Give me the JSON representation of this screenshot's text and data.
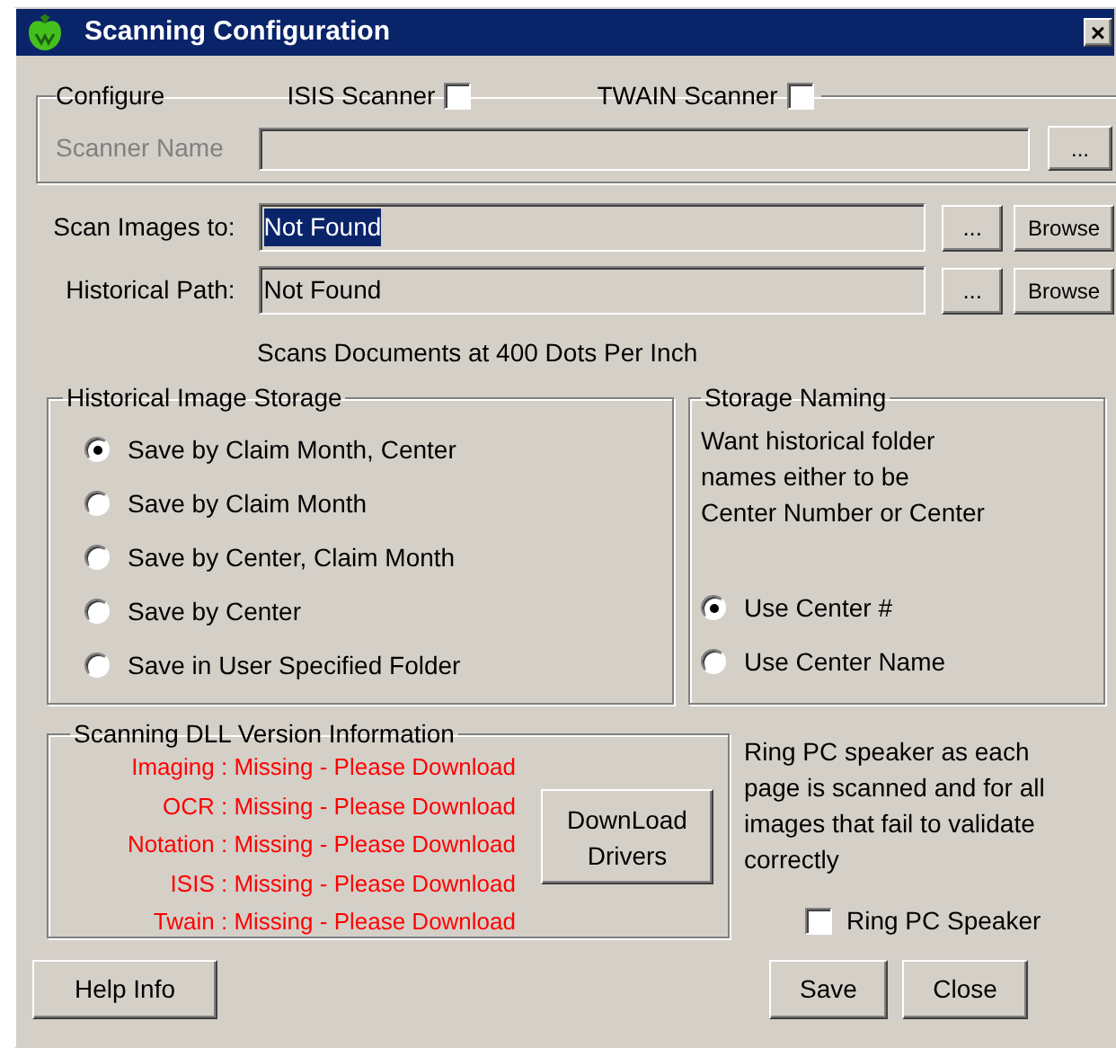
{
  "window": {
    "title": "Scanning Configuration",
    "close": "×"
  },
  "configure": {
    "legend": "Configure",
    "options": [
      {
        "label": "ISIS Scanner",
        "checked": false
      },
      {
        "label": "TWAIN Scanner",
        "checked": false
      }
    ],
    "scanner_name": {
      "label": "Scanner Name",
      "disabled": true,
      "button": "..."
    }
  },
  "paths": [
    {
      "label": "Scan Images to:",
      "value": "Not Found",
      "selected": true,
      "buttons": [
        "...",
        "Browse"
      ]
    },
    {
      "label": "Historical Path:",
      "value": "Not Found",
      "selected": false,
      "buttons": [
        "...",
        "Browse"
      ]
    }
  ],
  "resolution_note": "Scans Documents at 400 Dots Per Inch",
  "historical_storage": {
    "legend": "Historical Image Storage",
    "options": [
      {
        "label": "Save by Claim Month, Center",
        "selected": true
      },
      {
        "label": "Save by Claim Month",
        "selected": false
      },
      {
        "label": "Save by Center, Claim Month",
        "selected": false
      },
      {
        "label": "Save by Center",
        "selected": false
      },
      {
        "label": "Save in User Specified Folder",
        "selected": false
      }
    ]
  },
  "storage_naming": {
    "legend": "Storage Naming",
    "description": "Want historical folder\nnames either to be\nCenter Number or Center",
    "options": [
      {
        "label": "Use Center #",
        "selected": true
      },
      {
        "label": "Use Center Name",
        "selected": false
      }
    ]
  },
  "dll_info": {
    "legend": "Scanning DLL Version Information",
    "lines": [
      "Imaging : Missing - Please Download",
      "OCR : Missing - Please Download",
      "Notation : Missing - Please Download",
      "ISIS : Missing - Please Download",
      "Twain : Missing - Please Download"
    ],
    "button": "DownLoad Drivers"
  },
  "ring": {
    "description": "Ring PC speaker as each\npage is scanned and for all\nimages that fail to validate\ncorrectly",
    "checkbox": {
      "label": "Ring PC Speaker",
      "checked": false
    }
  },
  "footer": {
    "left": [
      "Help Info"
    ],
    "right": [
      "Save",
      "Close"
    ]
  }
}
